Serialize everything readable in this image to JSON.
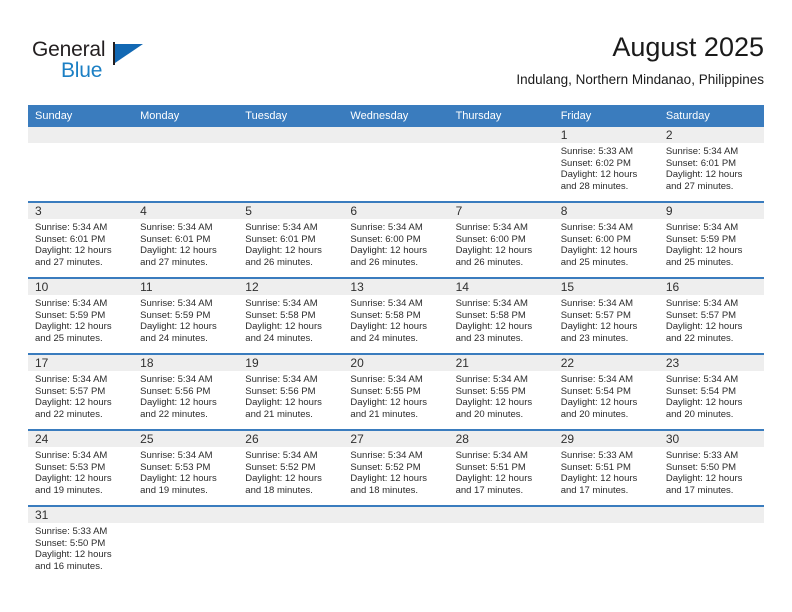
{
  "brand": {
    "name_part1": "General",
    "name_part2": "Blue",
    "flag_icon": "blue-triangle-flag",
    "accent_color": "#1268b3",
    "blue_text_color": "#1b7fc4"
  },
  "header": {
    "title": "August 2025",
    "subtitle": "Indulang, Northern Mindanao, Philippines"
  },
  "theme": {
    "header_row_color": "#3a7cbe",
    "date_band_color": "#eeeeee",
    "separator_color": "#3a7cbe",
    "text_color": "#2b2b2b"
  },
  "weekday_headers": [
    "Sunday",
    "Monday",
    "Tuesday",
    "Wednesday",
    "Thursday",
    "Friday",
    "Saturday"
  ],
  "weeks": [
    [
      {
        "day": "",
        "sunrise": "",
        "sunset": "",
        "daylight_line1": "",
        "daylight_line2": ""
      },
      {
        "day": "",
        "sunrise": "",
        "sunset": "",
        "daylight_line1": "",
        "daylight_line2": ""
      },
      {
        "day": "",
        "sunrise": "",
        "sunset": "",
        "daylight_line1": "",
        "daylight_line2": ""
      },
      {
        "day": "",
        "sunrise": "",
        "sunset": "",
        "daylight_line1": "",
        "daylight_line2": ""
      },
      {
        "day": "",
        "sunrise": "",
        "sunset": "",
        "daylight_line1": "",
        "daylight_line2": ""
      },
      {
        "day": "1",
        "sunrise": "Sunrise: 5:33 AM",
        "sunset": "Sunset: 6:02 PM",
        "daylight_line1": "Daylight: 12 hours",
        "daylight_line2": "and 28 minutes."
      },
      {
        "day": "2",
        "sunrise": "Sunrise: 5:34 AM",
        "sunset": "Sunset: 6:01 PM",
        "daylight_line1": "Daylight: 12 hours",
        "daylight_line2": "and 27 minutes."
      }
    ],
    [
      {
        "day": "3",
        "sunrise": "Sunrise: 5:34 AM",
        "sunset": "Sunset: 6:01 PM",
        "daylight_line1": "Daylight: 12 hours",
        "daylight_line2": "and 27 minutes."
      },
      {
        "day": "4",
        "sunrise": "Sunrise: 5:34 AM",
        "sunset": "Sunset: 6:01 PM",
        "daylight_line1": "Daylight: 12 hours",
        "daylight_line2": "and 27 minutes."
      },
      {
        "day": "5",
        "sunrise": "Sunrise: 5:34 AM",
        "sunset": "Sunset: 6:01 PM",
        "daylight_line1": "Daylight: 12 hours",
        "daylight_line2": "and 26 minutes."
      },
      {
        "day": "6",
        "sunrise": "Sunrise: 5:34 AM",
        "sunset": "Sunset: 6:00 PM",
        "daylight_line1": "Daylight: 12 hours",
        "daylight_line2": "and 26 minutes."
      },
      {
        "day": "7",
        "sunrise": "Sunrise: 5:34 AM",
        "sunset": "Sunset: 6:00 PM",
        "daylight_line1": "Daylight: 12 hours",
        "daylight_line2": "and 26 minutes."
      },
      {
        "day": "8",
        "sunrise": "Sunrise: 5:34 AM",
        "sunset": "Sunset: 6:00 PM",
        "daylight_line1": "Daylight: 12 hours",
        "daylight_line2": "and 25 minutes."
      },
      {
        "day": "9",
        "sunrise": "Sunrise: 5:34 AM",
        "sunset": "Sunset: 5:59 PM",
        "daylight_line1": "Daylight: 12 hours",
        "daylight_line2": "and 25 minutes."
      }
    ],
    [
      {
        "day": "10",
        "sunrise": "Sunrise: 5:34 AM",
        "sunset": "Sunset: 5:59 PM",
        "daylight_line1": "Daylight: 12 hours",
        "daylight_line2": "and 25 minutes."
      },
      {
        "day": "11",
        "sunrise": "Sunrise: 5:34 AM",
        "sunset": "Sunset: 5:59 PM",
        "daylight_line1": "Daylight: 12 hours",
        "daylight_line2": "and 24 minutes."
      },
      {
        "day": "12",
        "sunrise": "Sunrise: 5:34 AM",
        "sunset": "Sunset: 5:58 PM",
        "daylight_line1": "Daylight: 12 hours",
        "daylight_line2": "and 24 minutes."
      },
      {
        "day": "13",
        "sunrise": "Sunrise: 5:34 AM",
        "sunset": "Sunset: 5:58 PM",
        "daylight_line1": "Daylight: 12 hours",
        "daylight_line2": "and 24 minutes."
      },
      {
        "day": "14",
        "sunrise": "Sunrise: 5:34 AM",
        "sunset": "Sunset: 5:58 PM",
        "daylight_line1": "Daylight: 12 hours",
        "daylight_line2": "and 23 minutes."
      },
      {
        "day": "15",
        "sunrise": "Sunrise: 5:34 AM",
        "sunset": "Sunset: 5:57 PM",
        "daylight_line1": "Daylight: 12 hours",
        "daylight_line2": "and 23 minutes."
      },
      {
        "day": "16",
        "sunrise": "Sunrise: 5:34 AM",
        "sunset": "Sunset: 5:57 PM",
        "daylight_line1": "Daylight: 12 hours",
        "daylight_line2": "and 22 minutes."
      }
    ],
    [
      {
        "day": "17",
        "sunrise": "Sunrise: 5:34 AM",
        "sunset": "Sunset: 5:57 PM",
        "daylight_line1": "Daylight: 12 hours",
        "daylight_line2": "and 22 minutes."
      },
      {
        "day": "18",
        "sunrise": "Sunrise: 5:34 AM",
        "sunset": "Sunset: 5:56 PM",
        "daylight_line1": "Daylight: 12 hours",
        "daylight_line2": "and 22 minutes."
      },
      {
        "day": "19",
        "sunrise": "Sunrise: 5:34 AM",
        "sunset": "Sunset: 5:56 PM",
        "daylight_line1": "Daylight: 12 hours",
        "daylight_line2": "and 21 minutes."
      },
      {
        "day": "20",
        "sunrise": "Sunrise: 5:34 AM",
        "sunset": "Sunset: 5:55 PM",
        "daylight_line1": "Daylight: 12 hours",
        "daylight_line2": "and 21 minutes."
      },
      {
        "day": "21",
        "sunrise": "Sunrise: 5:34 AM",
        "sunset": "Sunset: 5:55 PM",
        "daylight_line1": "Daylight: 12 hours",
        "daylight_line2": "and 20 minutes."
      },
      {
        "day": "22",
        "sunrise": "Sunrise: 5:34 AM",
        "sunset": "Sunset: 5:54 PM",
        "daylight_line1": "Daylight: 12 hours",
        "daylight_line2": "and 20 minutes."
      },
      {
        "day": "23",
        "sunrise": "Sunrise: 5:34 AM",
        "sunset": "Sunset: 5:54 PM",
        "daylight_line1": "Daylight: 12 hours",
        "daylight_line2": "and 20 minutes."
      }
    ],
    [
      {
        "day": "24",
        "sunrise": "Sunrise: 5:34 AM",
        "sunset": "Sunset: 5:53 PM",
        "daylight_line1": "Daylight: 12 hours",
        "daylight_line2": "and 19 minutes."
      },
      {
        "day": "25",
        "sunrise": "Sunrise: 5:34 AM",
        "sunset": "Sunset: 5:53 PM",
        "daylight_line1": "Daylight: 12 hours",
        "daylight_line2": "and 19 minutes."
      },
      {
        "day": "26",
        "sunrise": "Sunrise: 5:34 AM",
        "sunset": "Sunset: 5:52 PM",
        "daylight_line1": "Daylight: 12 hours",
        "daylight_line2": "and 18 minutes."
      },
      {
        "day": "27",
        "sunrise": "Sunrise: 5:34 AM",
        "sunset": "Sunset: 5:52 PM",
        "daylight_line1": "Daylight: 12 hours",
        "daylight_line2": "and 18 minutes."
      },
      {
        "day": "28",
        "sunrise": "Sunrise: 5:34 AM",
        "sunset": "Sunset: 5:51 PM",
        "daylight_line1": "Daylight: 12 hours",
        "daylight_line2": "and 17 minutes."
      },
      {
        "day": "29",
        "sunrise": "Sunrise: 5:33 AM",
        "sunset": "Sunset: 5:51 PM",
        "daylight_line1": "Daylight: 12 hours",
        "daylight_line2": "and 17 minutes."
      },
      {
        "day": "30",
        "sunrise": "Sunrise: 5:33 AM",
        "sunset": "Sunset: 5:50 PM",
        "daylight_line1": "Daylight: 12 hours",
        "daylight_line2": "and 17 minutes."
      }
    ],
    [
      {
        "day": "31",
        "sunrise": "Sunrise: 5:33 AM",
        "sunset": "Sunset: 5:50 PM",
        "daylight_line1": "Daylight: 12 hours",
        "daylight_line2": "and 16 minutes."
      },
      {
        "day": "",
        "sunrise": "",
        "sunset": "",
        "daylight_line1": "",
        "daylight_line2": ""
      },
      {
        "day": "",
        "sunrise": "",
        "sunset": "",
        "daylight_line1": "",
        "daylight_line2": ""
      },
      {
        "day": "",
        "sunrise": "",
        "sunset": "",
        "daylight_line1": "",
        "daylight_line2": ""
      },
      {
        "day": "",
        "sunrise": "",
        "sunset": "",
        "daylight_line1": "",
        "daylight_line2": ""
      },
      {
        "day": "",
        "sunrise": "",
        "sunset": "",
        "daylight_line1": "",
        "daylight_line2": ""
      },
      {
        "day": "",
        "sunrise": "",
        "sunset": "",
        "daylight_line1": "",
        "daylight_line2": ""
      }
    ]
  ]
}
